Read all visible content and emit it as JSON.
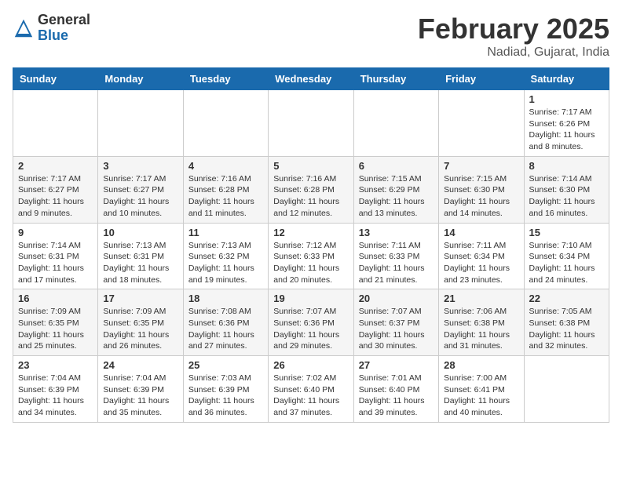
{
  "logo": {
    "general": "General",
    "blue": "Blue"
  },
  "title": "February 2025",
  "location": "Nadiad, Gujarat, India",
  "days_of_week": [
    "Sunday",
    "Monday",
    "Tuesday",
    "Wednesday",
    "Thursday",
    "Friday",
    "Saturday"
  ],
  "weeks": [
    [
      {
        "day": "",
        "info": ""
      },
      {
        "day": "",
        "info": ""
      },
      {
        "day": "",
        "info": ""
      },
      {
        "day": "",
        "info": ""
      },
      {
        "day": "",
        "info": ""
      },
      {
        "day": "",
        "info": ""
      },
      {
        "day": "1",
        "info": "Sunrise: 7:17 AM\nSunset: 6:26 PM\nDaylight: 11 hours and 8 minutes."
      }
    ],
    [
      {
        "day": "2",
        "info": "Sunrise: 7:17 AM\nSunset: 6:27 PM\nDaylight: 11 hours and 9 minutes."
      },
      {
        "day": "3",
        "info": "Sunrise: 7:17 AM\nSunset: 6:27 PM\nDaylight: 11 hours and 10 minutes."
      },
      {
        "day": "4",
        "info": "Sunrise: 7:16 AM\nSunset: 6:28 PM\nDaylight: 11 hours and 11 minutes."
      },
      {
        "day": "5",
        "info": "Sunrise: 7:16 AM\nSunset: 6:28 PM\nDaylight: 11 hours and 12 minutes."
      },
      {
        "day": "6",
        "info": "Sunrise: 7:15 AM\nSunset: 6:29 PM\nDaylight: 11 hours and 13 minutes."
      },
      {
        "day": "7",
        "info": "Sunrise: 7:15 AM\nSunset: 6:30 PM\nDaylight: 11 hours and 14 minutes."
      },
      {
        "day": "8",
        "info": "Sunrise: 7:14 AM\nSunset: 6:30 PM\nDaylight: 11 hours and 16 minutes."
      }
    ],
    [
      {
        "day": "9",
        "info": "Sunrise: 7:14 AM\nSunset: 6:31 PM\nDaylight: 11 hours and 17 minutes."
      },
      {
        "day": "10",
        "info": "Sunrise: 7:13 AM\nSunset: 6:31 PM\nDaylight: 11 hours and 18 minutes."
      },
      {
        "day": "11",
        "info": "Sunrise: 7:13 AM\nSunset: 6:32 PM\nDaylight: 11 hours and 19 minutes."
      },
      {
        "day": "12",
        "info": "Sunrise: 7:12 AM\nSunset: 6:33 PM\nDaylight: 11 hours and 20 minutes."
      },
      {
        "day": "13",
        "info": "Sunrise: 7:11 AM\nSunset: 6:33 PM\nDaylight: 11 hours and 21 minutes."
      },
      {
        "day": "14",
        "info": "Sunrise: 7:11 AM\nSunset: 6:34 PM\nDaylight: 11 hours and 23 minutes."
      },
      {
        "day": "15",
        "info": "Sunrise: 7:10 AM\nSunset: 6:34 PM\nDaylight: 11 hours and 24 minutes."
      }
    ],
    [
      {
        "day": "16",
        "info": "Sunrise: 7:09 AM\nSunset: 6:35 PM\nDaylight: 11 hours and 25 minutes."
      },
      {
        "day": "17",
        "info": "Sunrise: 7:09 AM\nSunset: 6:35 PM\nDaylight: 11 hours and 26 minutes."
      },
      {
        "day": "18",
        "info": "Sunrise: 7:08 AM\nSunset: 6:36 PM\nDaylight: 11 hours and 27 minutes."
      },
      {
        "day": "19",
        "info": "Sunrise: 7:07 AM\nSunset: 6:36 PM\nDaylight: 11 hours and 29 minutes."
      },
      {
        "day": "20",
        "info": "Sunrise: 7:07 AM\nSunset: 6:37 PM\nDaylight: 11 hours and 30 minutes."
      },
      {
        "day": "21",
        "info": "Sunrise: 7:06 AM\nSunset: 6:38 PM\nDaylight: 11 hours and 31 minutes."
      },
      {
        "day": "22",
        "info": "Sunrise: 7:05 AM\nSunset: 6:38 PM\nDaylight: 11 hours and 32 minutes."
      }
    ],
    [
      {
        "day": "23",
        "info": "Sunrise: 7:04 AM\nSunset: 6:39 PM\nDaylight: 11 hours and 34 minutes."
      },
      {
        "day": "24",
        "info": "Sunrise: 7:04 AM\nSunset: 6:39 PM\nDaylight: 11 hours and 35 minutes."
      },
      {
        "day": "25",
        "info": "Sunrise: 7:03 AM\nSunset: 6:39 PM\nDaylight: 11 hours and 36 minutes."
      },
      {
        "day": "26",
        "info": "Sunrise: 7:02 AM\nSunset: 6:40 PM\nDaylight: 11 hours and 37 minutes."
      },
      {
        "day": "27",
        "info": "Sunrise: 7:01 AM\nSunset: 6:40 PM\nDaylight: 11 hours and 39 minutes."
      },
      {
        "day": "28",
        "info": "Sunrise: 7:00 AM\nSunset: 6:41 PM\nDaylight: 11 hours and 40 minutes."
      },
      {
        "day": "",
        "info": ""
      }
    ]
  ]
}
